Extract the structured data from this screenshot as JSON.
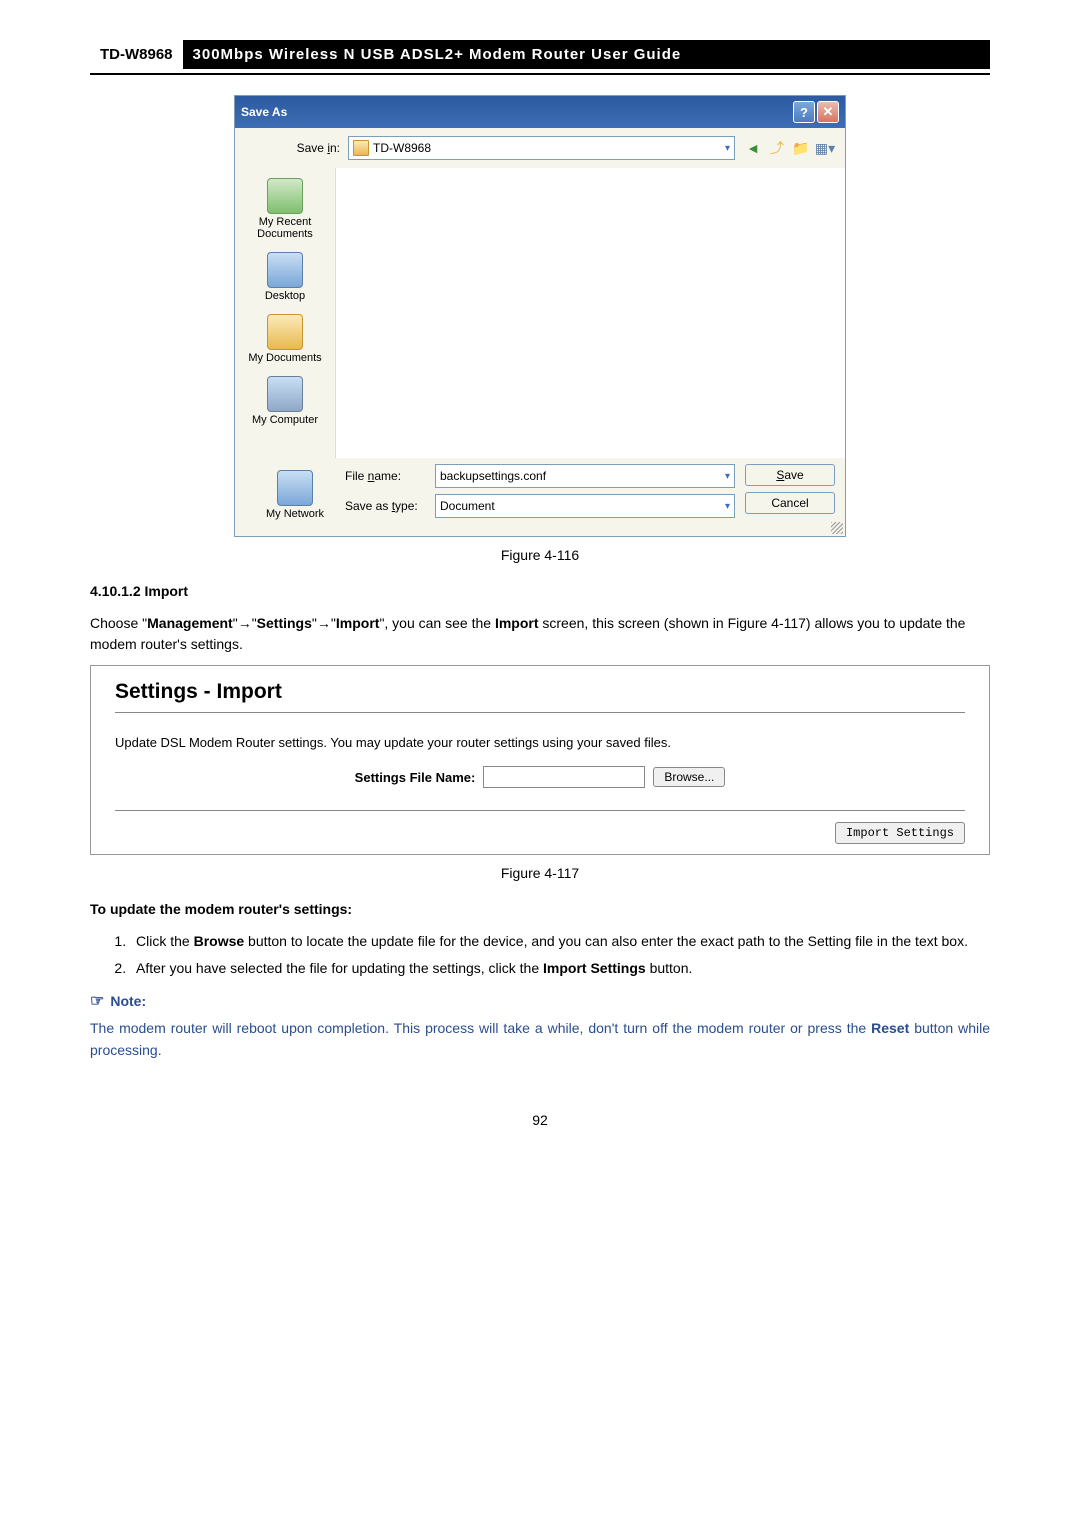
{
  "header": {
    "model": "TD-W8968",
    "title": "300Mbps Wireless N USB ADSL2+ Modem Router User Guide"
  },
  "saveAs": {
    "title": "Save As",
    "saveInLabel": "Save in:",
    "saveInValue": "TD-W8968",
    "places": {
      "recent": "My Recent Documents",
      "desktop": "Desktop",
      "mydocs": "My Documents",
      "mycomp": "My Computer",
      "mynet": "My Network"
    },
    "fileNameLabel": "File name:",
    "fileNameValue": "backupsettings.conf",
    "saveTypeLabel": "Save as type:",
    "saveTypeValue": "Document",
    "saveBtn": "Save",
    "cancelBtn": "Cancel"
  },
  "captions": {
    "fig116": "Figure 4-116",
    "fig117": "Figure 4-117"
  },
  "section": {
    "heading": "4.10.1.2  Import",
    "choosePre": "Choose \"",
    "mgmt": "Management",
    "settings": "Settings",
    "import": "Import",
    "chooseMid": "\", you can see the ",
    "importBold": "Import",
    "choosePost": " screen, this screen (shown in Figure 4-117) allows you to update the modem router's settings."
  },
  "panel": {
    "title": "Settings - Import",
    "desc": "Update DSL Modem Router settings. You may update your router settings using your saved files.",
    "fileLabel": "Settings File Name:",
    "browseBtn": "Browse...",
    "importBtn": "Import Settings"
  },
  "steps": {
    "heading": "To update the modem router's settings:",
    "s1a": "Click the ",
    "s1b": "Browse",
    "s1c": " button to locate the update file for the device, and you can also enter the exact path to the Setting file in the text box.",
    "s2a": "After you have selected the file for updating the settings, click the ",
    "s2b": "Import Settings",
    "s2c": " button."
  },
  "note": {
    "label": "Note:",
    "text1": "The modem router will reboot upon completion. This process will take a while, don't turn off the modem router or press the ",
    "reset": "Reset",
    "text2": " button while processing."
  },
  "pageNum": "92"
}
